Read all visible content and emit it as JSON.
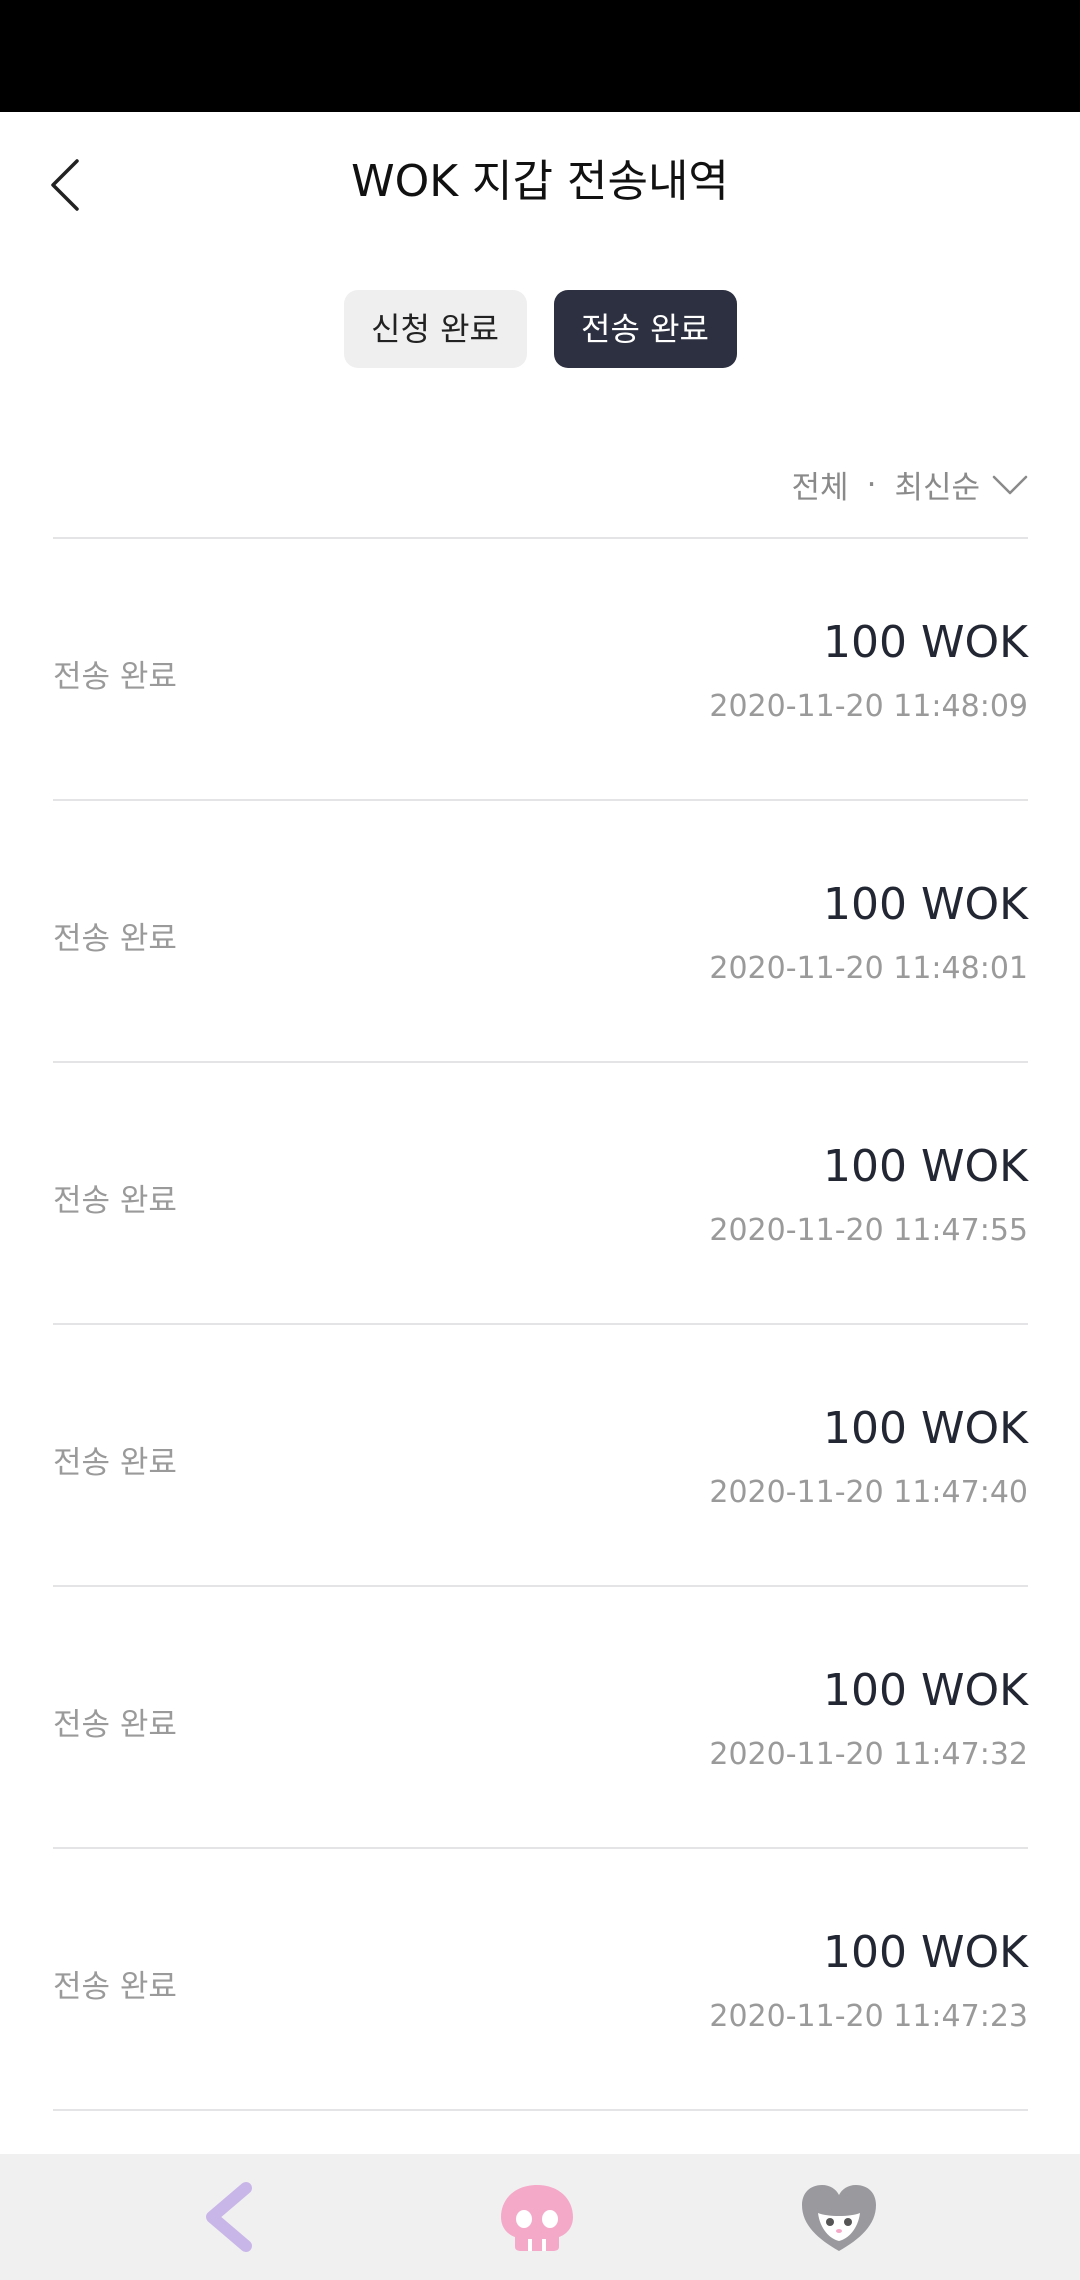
{
  "header": {
    "title": "WOK 지갑 전송내역",
    "back_icon": "chevron-left-icon"
  },
  "tabs": [
    {
      "label": "신청 완료",
      "active": false
    },
    {
      "label": "전송 완료",
      "active": true
    }
  ],
  "filter": {
    "scope": "전체",
    "separator": "·",
    "sort": "최신순",
    "chevron_icon": "chevron-down-icon"
  },
  "transactions": [
    {
      "status": "전송 완료",
      "amount": "100 WOK",
      "datetime": "2020-11-20 11:48:09"
    },
    {
      "status": "전송 완료",
      "amount": "100 WOK",
      "datetime": "2020-11-20 11:48:01"
    },
    {
      "status": "전송 완료",
      "amount": "100 WOK",
      "datetime": "2020-11-20 11:47:55"
    },
    {
      "status": "전송 완료",
      "amount": "100 WOK",
      "datetime": "2020-11-20 11:47:40"
    },
    {
      "status": "전송 완료",
      "amount": "100 WOK",
      "datetime": "2020-11-20 11:47:32"
    },
    {
      "status": "전송 완료",
      "amount": "100 WOK",
      "datetime": "2020-11-20 11:47:23"
    }
  ],
  "bottom_nav": {
    "items": [
      "back-arrow-icon",
      "skull-icon",
      "character-icon"
    ]
  },
  "colors": {
    "active_tab": "#2d3040",
    "inactive_tab": "#efeff0",
    "nav_back": "#c9b6e8",
    "nav_skull": "#f5a9c8",
    "nav_character": "#9a9a9e"
  }
}
